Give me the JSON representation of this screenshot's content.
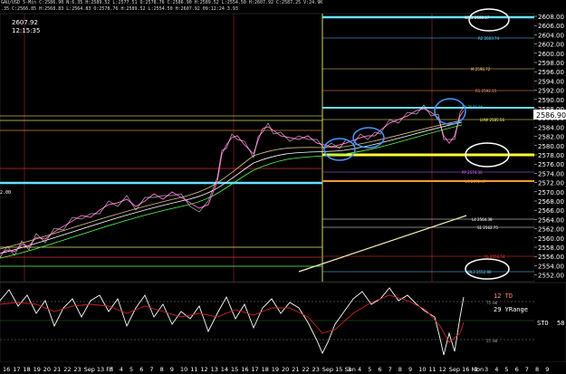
{
  "header": {
    "line1": "GAU/USD  5-Min  C:2586.90  N:6.35  H:2589.52  L:2577.51  O:2578.76  C:2586.90  H:2589.52  L:2554.50  H:2607.92  C:2587.25  V:24.9K",
    "line2": ".35  C:2566.85  H:2568.83  L:2564.83  O:2578.76  H:2589.52  L:2554.50  H:2607.92  09:12:24  3.93"
  },
  "hi_price": "2607.92",
  "hi_time": "12:15:35",
  "price_axis": [
    "2608.00",
    "2606.00",
    "2604.00",
    "2602.00",
    "2600.00",
    "2598.00",
    "2596.00",
    "2594.00",
    "2592.00",
    "2590.00",
    "2588.00",
    "2586.00",
    "2584.00",
    "2582.00",
    "2580.00",
    "2578.00",
    "2576.00",
    "2574.00",
    "2572.00",
    "2570.00",
    "2568.00",
    "2566.00",
    "2564.00",
    "2562.00",
    "2560.00",
    "2558.00",
    "2556.00",
    "2554.00",
    "2552.00"
  ],
  "current_price": "2586.90",
  "left_axis_label": "2.00",
  "levels": [
    {
      "label": "WH3 2608.17",
      "color": "#ffffff"
    },
    {
      "label": "R2 2603.74",
      "color": "#66ccff"
    },
    {
      "label": "M 2596.72",
      "color": "#ffcc66"
    },
    {
      "label": "R1 2592.15",
      "color": "#ff9966"
    },
    {
      "label": "R3 2588.06",
      "color": "#66ccff"
    },
    {
      "label": "LHW 2585.56",
      "color": "#ffff66"
    },
    {
      "label": "PP 2574.36",
      "color": "#cc66ff"
    },
    {
      "label": "L3 2572.47",
      "color": "#ff9933"
    },
    {
      "label": "L4 2564.38",
      "color": "#ffffff"
    },
    {
      "label": "S1 2562.75",
      "color": "#ffffff"
    },
    {
      "label": "YL 2556.54",
      "color": "#ff3333"
    },
    {
      "label": "WL3 2552.80",
      "color": "#66ccff"
    }
  ],
  "date_labels": [
    "16",
    "17",
    "18",
    "19",
    "20",
    "21",
    "22",
    "23",
    "Sep 13 Fri",
    "3",
    "4",
    "5",
    "6",
    "7",
    "8",
    "9",
    "10",
    "11",
    "12",
    "13",
    "14",
    "15",
    "16",
    "17",
    "18",
    "19",
    "20",
    "21",
    "22",
    "23",
    "Sep 15 Sun",
    "3",
    "4",
    "5",
    "6",
    "7",
    "8",
    "9",
    "10",
    "11",
    "12",
    "Sep 16 Mon",
    "2",
    "3",
    "4",
    "5",
    "6",
    "7",
    "8",
    "9"
  ],
  "indicator": {
    "td": "12 TD",
    "yrange": "29 YRange",
    "sto": "STO",
    "sto_val": "58",
    "lvl75": "75.00",
    "lvl25": "25.00"
  }
}
